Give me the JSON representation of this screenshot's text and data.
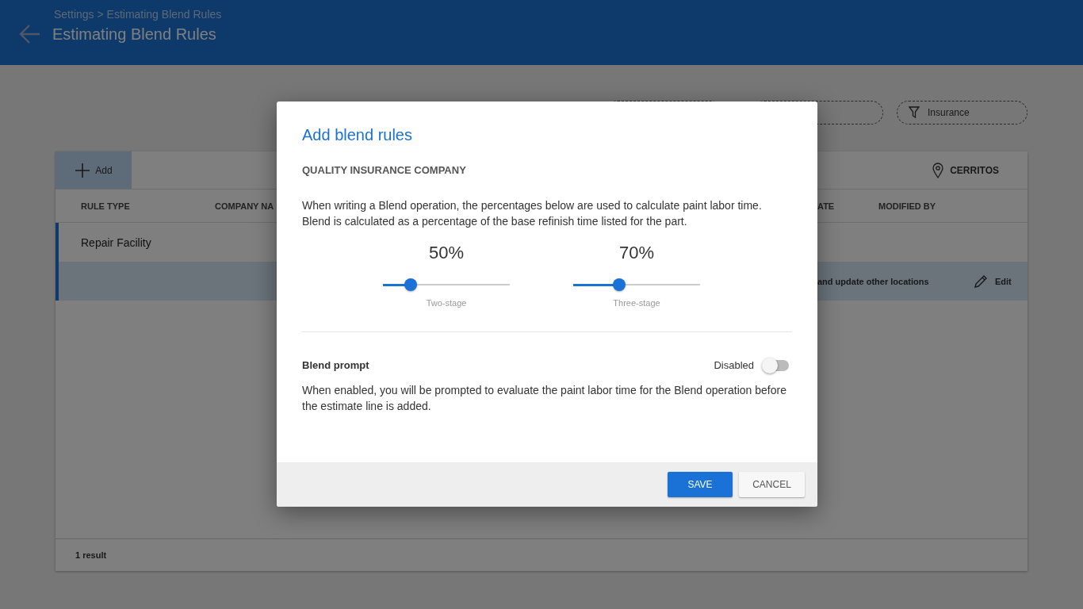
{
  "header": {
    "breadcrumb": "Settings > Estimating Blend Rules",
    "title": "Estimating Blend Rules"
  },
  "filters": [
    {
      "label": "Insurance"
    }
  ],
  "toolbar": {
    "add": "Add",
    "location": "CERRITOS"
  },
  "table": {
    "columns": [
      "RULE TYPE",
      "COMPANY NA",
      "ATE",
      "MODIFIED BY"
    ],
    "rows": [
      {
        "rule_type": "Repair Facility",
        "note": "",
        "action": "",
        "selected": false
      },
      {
        "rule_type": "",
        "note": "and update other locations",
        "action": "Edit",
        "selected": true
      }
    ]
  },
  "result_count": "1 result",
  "dialog": {
    "title": "Add blend rules",
    "company": "QUALITY INSURANCE COMPANY",
    "description": "When writing a Blend operation, the percentages below are used to calculate paint labor time. Blend is calculated as a percentage of the base refinish time listed for the part.",
    "sliders": [
      {
        "reading": "50%",
        "label": "Two-stage",
        "level": 0.22
      },
      {
        "reading": "70%",
        "label": "Three-stage",
        "level": 0.36
      }
    ],
    "prompt": {
      "label": "Blend prompt",
      "state": "Disabled",
      "on": false,
      "description": "When enabled, you will be prompted to evaluate the paint labor time for the Blend operation before the estimate line is added."
    },
    "buttons": [
      {
        "label": "SAVE",
        "kind": "primary"
      },
      {
        "label": "CANCEL",
        "kind": "secondary"
      }
    ]
  }
}
